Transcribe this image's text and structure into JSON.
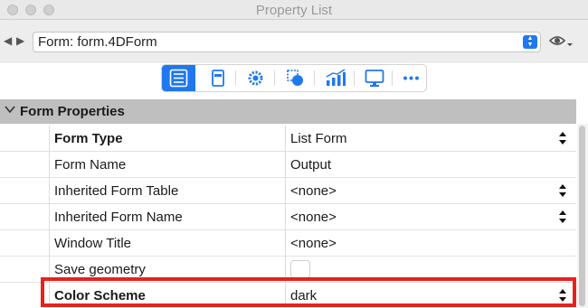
{
  "window": {
    "title": "Property List",
    "controls": [
      "close",
      "minimize",
      "maximize"
    ]
  },
  "nav": {
    "form_selector": "Form: form.4DForm"
  },
  "toolbar": {
    "buttons": [
      {
        "icon": "list-icon",
        "active": true
      },
      {
        "icon": "object-icon",
        "active": false
      },
      {
        "icon": "gear-icon",
        "active": false
      },
      {
        "icon": "shape-icon",
        "active": false
      },
      {
        "icon": "chart-icon",
        "active": false
      },
      {
        "icon": "monitor-icon",
        "active": false
      },
      {
        "icon": "more-icon",
        "active": false
      }
    ]
  },
  "section": {
    "title": "Form Properties",
    "rows": [
      {
        "name": "Form Type",
        "bold": true,
        "value": "List Form",
        "control": "stepper"
      },
      {
        "name": "Form Name",
        "bold": false,
        "value": "Output",
        "control": "none"
      },
      {
        "name": "Inherited Form Table",
        "bold": false,
        "value": "<none>",
        "control": "stepper"
      },
      {
        "name": "Inherited Form Name",
        "bold": false,
        "value": "<none>",
        "control": "stepper"
      },
      {
        "name": "Window Title",
        "bold": false,
        "value": "<none>",
        "control": "none"
      },
      {
        "name": "Save geometry",
        "bold": false,
        "value": "",
        "control": "checkbox"
      },
      {
        "name": "Color Scheme",
        "bold": true,
        "value": "dark",
        "control": "stepper"
      }
    ]
  },
  "colors": {
    "accent": "#1f78f0",
    "highlight": "#e8211d",
    "section_header": "#bfbfbf"
  }
}
